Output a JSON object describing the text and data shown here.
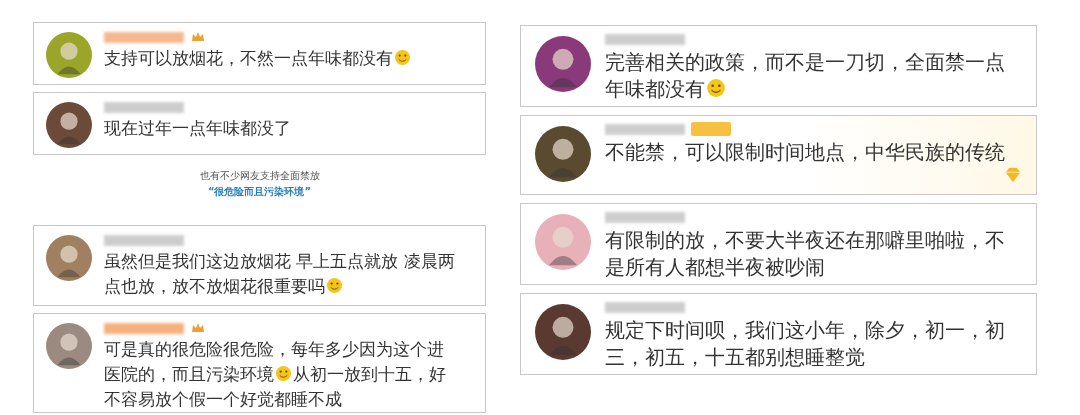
{
  "left_comments": [
    {
      "color": "#f5b183",
      "badge": true,
      "text": "支持可以放烟花，不然一点年味都没有",
      "emoji": true
    },
    {
      "color": "#c8c8c8",
      "badge": false,
      "text": "现在过年一点年味都没了",
      "emoji": false
    }
  ],
  "caption": {
    "line1": "也有不少网友支持全面禁放",
    "line2": "“很危险而且污染环境”"
  },
  "left_comments_2": [
    {
      "color": "#c8c8c8",
      "badge": false,
      "text": "虽然但是我们这边放烟花 早上五点就放 凌晨两点也放，放不放烟花很重要吗",
      "emoji": true
    },
    {
      "color": "#f5a870",
      "badge": true,
      "text": "可是真的很危险很危险，每年多少因为这个进医院的，而且污染环境",
      "emoji": true,
      "text_after": "从初一放到十五，好不容易放个假一个好觉都睡不成"
    }
  ],
  "right_comments": [
    {
      "color": "#c8c8c8",
      "badge": false,
      "text": "完善相关的政策，而不是一刀切，全面禁一点年味都没有",
      "emoji": true
    },
    {
      "color": "#c8c8c8",
      "badge": true,
      "text": "不能禁，可以限制时间地点，中华民族的传统",
      "emoji": false,
      "decor": true
    },
    {
      "color": "#c8c8c8",
      "badge": false,
      "text": "有限制的放，不要大半夜还在那噼里啪啦，不是所有人都想半夜被吵闹",
      "emoji": false
    },
    {
      "color": "#c8c8c8",
      "badge": false,
      "text": "规定下时间呗，我们这小年，除夕，初一，初三，初五，十五都别想睡整觉",
      "emoji": false
    }
  ]
}
